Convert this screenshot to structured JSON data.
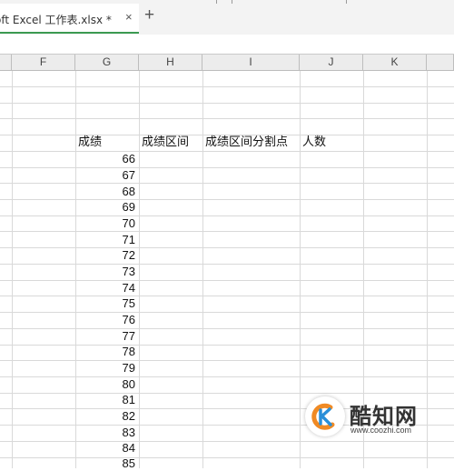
{
  "tab": {
    "title": "oft Excel 工作表.xlsx *",
    "close_glyph": "×",
    "new_glyph": "+"
  },
  "columns": [
    "F",
    "G",
    "H",
    "I",
    "J",
    "K"
  ],
  "headers": {
    "g": "成绩",
    "h": "成绩区间",
    "i": "成绩区间分割点",
    "j": "人数"
  },
  "scores": [
    "66",
    "67",
    "68",
    "69",
    "70",
    "71",
    "72",
    "73",
    "74",
    "75",
    "76",
    "77",
    "78",
    "79",
    "80",
    "81",
    "82",
    "83",
    "84",
    "85"
  ],
  "watermark": {
    "name": "酷知网",
    "url": "www.coozhi.com"
  },
  "colors": {
    "tab_accent": "#3c9a52",
    "logo_orange": "#f08a24",
    "logo_blue": "#2a8fd8"
  }
}
